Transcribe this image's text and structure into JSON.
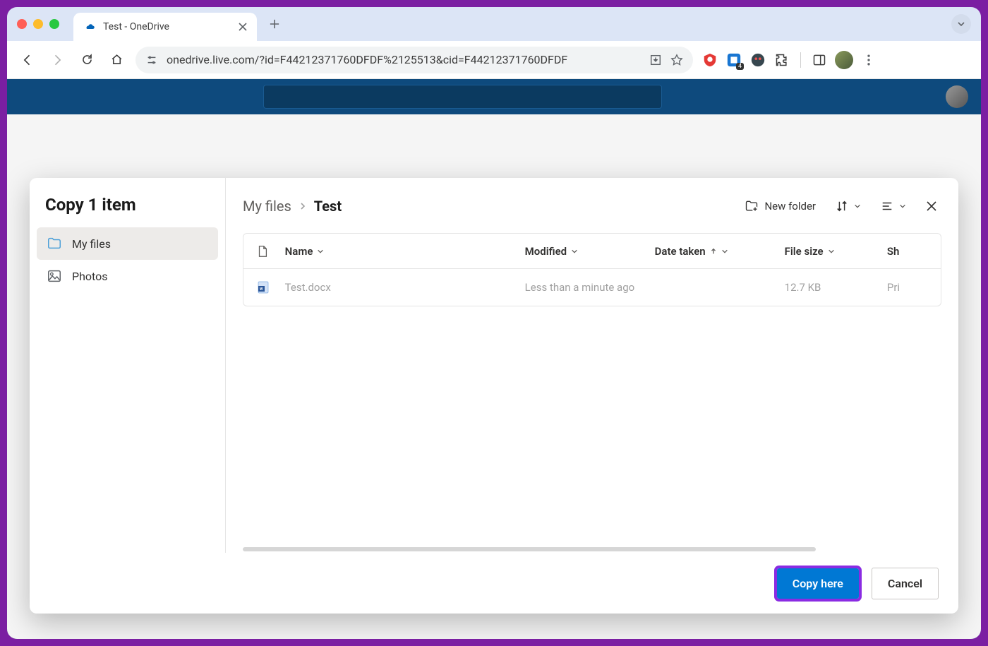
{
  "browser": {
    "tab_title": "Test - OneDrive",
    "url": "onedrive.live.com/?id=F44212371760DFDF%2125513&cid=F44212371760DFDF"
  },
  "dialog": {
    "title": "Copy 1 item",
    "sidebar": {
      "items": [
        {
          "label": "My files",
          "icon": "folder",
          "active": true
        },
        {
          "label": "Photos",
          "icon": "photo",
          "active": false
        }
      ]
    },
    "breadcrumb": {
      "root": "My files",
      "current": "Test"
    },
    "actions": {
      "new_folder": "New folder"
    },
    "table": {
      "headers": {
        "name": "Name",
        "modified": "Modified",
        "date_taken": "Date taken",
        "file_size": "File size",
        "sharing": "Sh"
      },
      "rows": [
        {
          "name": "Test.docx",
          "modified": "Less than a minute ago",
          "date_taken": "",
          "file_size": "12.7 KB",
          "sharing": "Pri"
        }
      ]
    },
    "footer": {
      "primary": "Copy here",
      "secondary": "Cancel"
    }
  }
}
